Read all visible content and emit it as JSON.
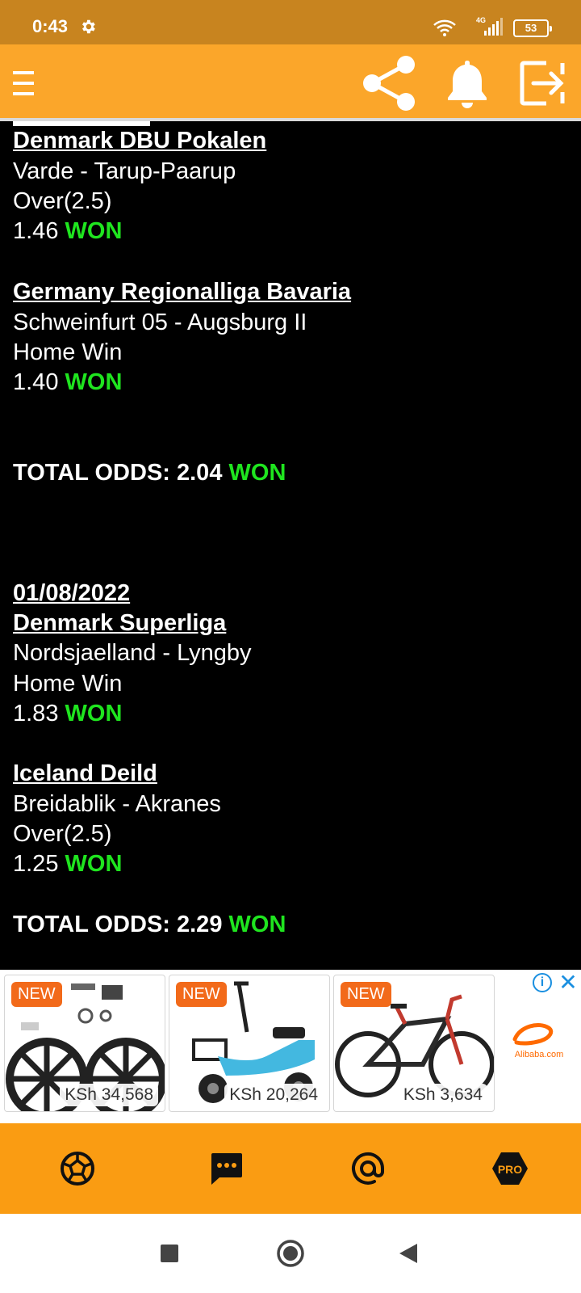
{
  "status_bar": {
    "time": "0:43",
    "network": "4G",
    "battery": "53"
  },
  "app_bar": {
    "icons": [
      "menu-icon",
      "share-icon",
      "bell-icon",
      "exit-icon"
    ]
  },
  "tips": [
    {
      "league": "Denmark DBU Pokalen",
      "match": "Varde - Tarup-Paarup",
      "pick": "Over(2.5)",
      "odds": "1.46",
      "result": "WON"
    },
    {
      "league": "Germany Regionalliga Bavaria",
      "match": "Schweinfurt 05 - Augsburg II",
      "pick": "Home Win",
      "odds": "1.40",
      "result": "WON"
    }
  ],
  "total_1": {
    "label": "TOTAL ODDS: 2.04",
    "result": "WON"
  },
  "date_2": "01/08/2022",
  "tips_2": [
    {
      "league": "Denmark Superliga",
      "match": "Nordsjaelland - Lyngby",
      "pick": "Home Win",
      "odds": "1.83",
      "result": "WON"
    },
    {
      "league": "Iceland Deild",
      "match": "Breidablik - Akranes",
      "pick": "Over(2.5)",
      "odds": "1.25",
      "result": "WON"
    }
  ],
  "total_2": {
    "label": "TOTAL ODDS: 2.29",
    "result": "WON"
  },
  "ad": {
    "cards": [
      {
        "badge": "NEW",
        "price": "KSh 34,568"
      },
      {
        "badge": "NEW",
        "price": "KSh 20,264"
      },
      {
        "badge": "NEW",
        "price": "KSh 3,634"
      }
    ],
    "brand": "Alibaba.com"
  },
  "bottom_nav": {
    "icons": [
      "football-icon",
      "chat-icon",
      "at-sign-icon",
      "pro-icon"
    ],
    "pro_label": "PRO"
  },
  "colors": {
    "status_bar": "#c8841f",
    "app_bar": "#fba62a",
    "won": "#1fe51f",
    "bottom_nav": "#fa9c12"
  }
}
